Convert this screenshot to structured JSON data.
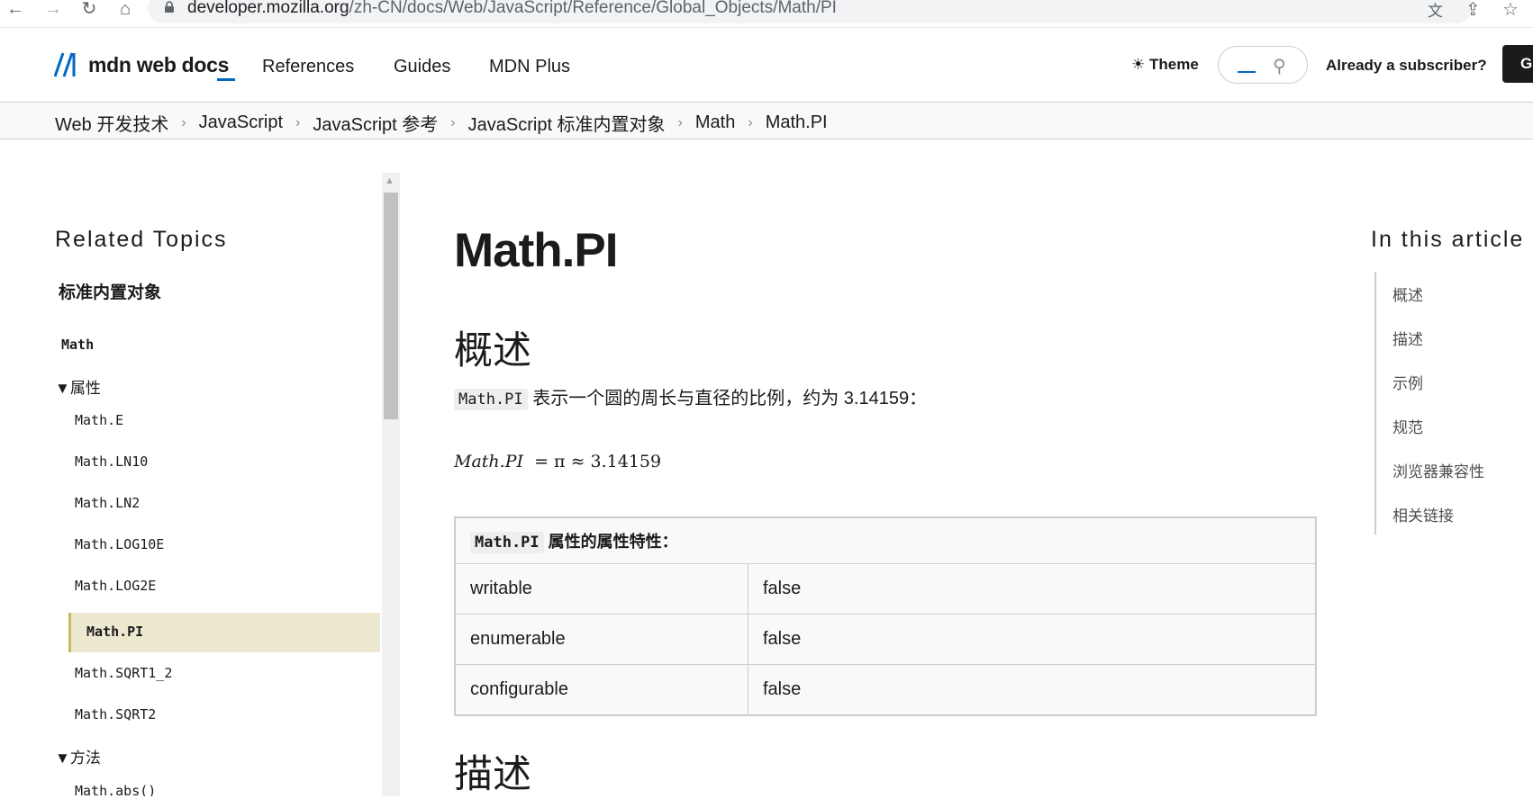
{
  "browser": {
    "url_host": "developer.mozilla.org",
    "url_path": "/zh-CN/docs/Web/JavaScript/Reference/Global_Objects/Math/PI"
  },
  "header": {
    "logo_text": "mdn web docs",
    "nav": [
      "References",
      "Guides",
      "MDN Plus"
    ],
    "theme_label": "Theme",
    "subscriber_label": "Already a subscriber?",
    "get_label": "G"
  },
  "breadcrumb": [
    "Web 开发技术",
    "JavaScript",
    "JavaScript 参考",
    "JavaScript 标准内置对象",
    "Math",
    "Math.PI"
  ],
  "sidebar": {
    "title": "Related Topics",
    "group": "标准内置对象",
    "math_label": "Math",
    "properties_label": "属性",
    "properties": [
      "Math.E",
      "Math.LN10",
      "Math.LN2",
      "Math.LOG10E",
      "Math.LOG2E",
      "Math.PI",
      "Math.SQRT1_2",
      "Math.SQRT2"
    ],
    "active_property": "Math.PI",
    "methods_label": "方法",
    "methods_first": "Math.abs()"
  },
  "main": {
    "title": "Math.PI",
    "overview_heading": "概述",
    "overview_code": "Math.PI",
    "overview_text": "表示一个圆的周长与直径的比例，约为 3.14159：",
    "formula_lhs": "Math.PI",
    "formula_rhs": "= π ≈ 3.14159",
    "table_header_code": "Math.PI",
    "table_header_text": "属性的属性特性：",
    "table_rows": [
      {
        "key": "writable",
        "value": "false"
      },
      {
        "key": "enumerable",
        "value": "false"
      },
      {
        "key": "configurable",
        "value": "false"
      }
    ],
    "description_heading": "描述"
  },
  "toc": {
    "title": "In this article",
    "items": [
      "概述",
      "描述",
      "示例",
      "规范",
      "浏览器兼容性",
      "相关链接"
    ]
  }
}
